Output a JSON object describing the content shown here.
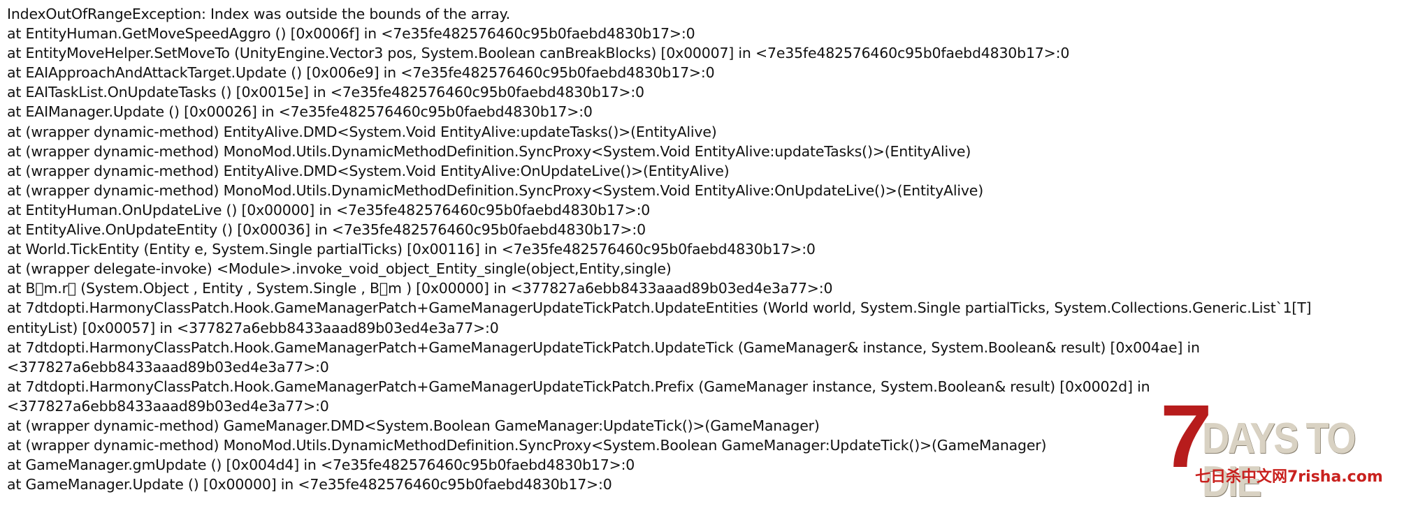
{
  "log_lines": [
    "IndexOutOfRangeException: Index was outside the bounds of the array.",
    "  at EntityHuman.GetMoveSpeedAggro () [0x0006f] in <7e35fe482576460c95b0faebd4830b17>:0",
    "  at EntityMoveHelper.SetMoveTo (UnityEngine.Vector3   pos, System.Boolean   canBreakBlocks) [0x00007] in <7e35fe482576460c95b0faebd4830b17>:0",
    "  at EAIApproachAndAttackTarget.Update () [0x006e9] in <7e35fe482576460c95b0faebd4830b17>:0",
    "  at EAITaskList.OnUpdateTasks () [0x0015e] in <7e35fe482576460c95b0faebd4830b17>:0",
    "  at EAIManager.Update () [0x00026] in <7e35fe482576460c95b0faebd4830b17>:0",
    "  at (wrapper dynamic-method) EntityAlive.DMD<System.Void EntityAlive:updateTasks()>(EntityAlive)",
    "  at (wrapper dynamic-method) MonoMod.Utils.DynamicMethodDefinition.SyncProxy<System.Void EntityAlive:updateTasks()>(EntityAlive)",
    "  at (wrapper dynamic-method) EntityAlive.DMD<System.Void EntityAlive:OnUpdateLive()>(EntityAlive)",
    "  at (wrapper dynamic-method) MonoMod.Utils.DynamicMethodDefinition.SyncProxy<System.Void EntityAlive:OnUpdateLive()>(EntityAlive)",
    "  at EntityHuman.OnUpdateLive () [0x00000] in <7e35fe482576460c95b0faebd4830b17>:0",
    "  at EntityAlive.OnUpdateEntity () [0x00036] in <7e35fe482576460c95b0faebd4830b17>:0",
    "  at World.TickEntity (Entity e, System.Single   partialTicks) [0x00116] in <7e35fe482576460c95b0faebd4830b17>:0",
    "  at (wrapper delegate-invoke) <Module>.invoke_void_object_Entity_single(object,Entity,single)",
    "  at B\u0000m.r\u0000 (System.Object , Entity , System.Single , B\u0000m ) [0x00000] in <377827a6ebb8433aaad89b03ed4e3a77>:0",
    "  at   7dtdopti.HarmonyClassPatch.Hook.GameManagerPatch+GameManagerUpdateTickPatch.UpdateEntities (World   world, System.Single   partialTicks, System.Collections.Generic.List`1[T]",
    "  entityList) [0x00057] in <377827a6ebb8433aaad89b03ed4e3a77>:0",
    "  at   7dtdopti.HarmonyClassPatch.Hook.GameManagerPatch+GameManagerUpdateTickPatch.UpdateTick (GameManager&    instance, System.Boolean&    result) [0x004ae] in",
    "<377827a6ebb8433aaad89b03ed4e3a77>:0",
    "  at   7dtdopti.HarmonyClassPatch.Hook.GameManagerPatch+GameManagerUpdateTickPatch.Prefix (GameManager    instance, System.Boolean&    result) [0x0002d] in",
    "<377827a6ebb8433aaad89b03ed4e3a77>:0",
    "  at (wrapper dynamic-method) GameManager.DMD<System.Boolean GameManager:UpdateTick()>(GameManager)",
    "  at (wrapper dynamic-method) MonoMod.Utils.DynamicMethodDefinition.SyncProxy<System.Boolean GameManager:UpdateTick()>(GameManager)",
    "  at GameManager.gmUpdate () [0x004d4] in <7e35fe482576460c95b0faebd4830b17>:0",
    "  at GameManager.Update () [0x00000] in <7e35fe482576460c95b0faebd4830b17>:0"
  ],
  "logo": {
    "number": "7",
    "title": "DAYS TO DIE",
    "subtitle": "七日杀中文网7risha.com",
    "red": "#b71c1c",
    "beige": "#d9d2c3"
  }
}
